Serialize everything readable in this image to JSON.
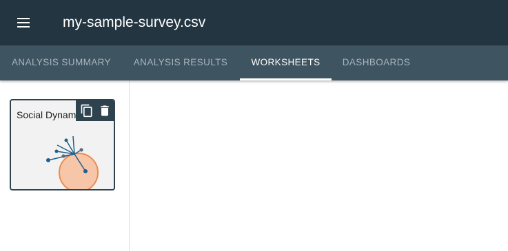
{
  "header": {
    "menu_icon": "hamburger-menu-icon",
    "title": "my-sample-survey.csv"
  },
  "tabs": [
    {
      "label": "ANALYSIS SUMMARY",
      "active": false
    },
    {
      "label": "ANALYSIS RESULTS",
      "active": false
    },
    {
      "label": "WORKSHEETS",
      "active": true
    },
    {
      "label": "DASHBOARDS",
      "active": false
    }
  ],
  "worksheets": [
    {
      "title": "Social Dynamics",
      "actions": [
        {
          "name": "duplicate",
          "icon": "copy-icon"
        },
        {
          "name": "delete",
          "icon": "trash-icon"
        }
      ],
      "thumbnail": "network-graph-icon"
    }
  ],
  "colors": {
    "header_bg": "#223541",
    "tab_bar_bg": "#3e5461",
    "tab_active": "#ffffff",
    "tab_inactive": "#a9b5bc",
    "card_border": "#2f434f",
    "node_blue": "#1f5f8b",
    "highlight_fill": "#f7c6a8",
    "highlight_stroke": "#ef8a4d"
  }
}
